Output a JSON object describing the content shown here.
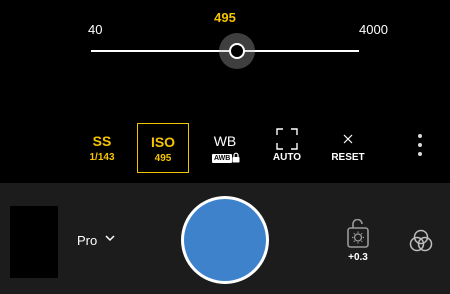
{
  "slider": {
    "value": "495",
    "min_label": "40",
    "max_label": "4000",
    "level_fraction": 0.55
  },
  "modes": {
    "ss": {
      "label": "SS",
      "value": "1/143"
    },
    "iso": {
      "label": "ISO",
      "value": "495",
      "selected": true
    },
    "wb": {
      "label": "WB",
      "badge": "AWB"
    },
    "focus": {
      "label": "AUTO",
      "icon": "focus-frame-icon"
    },
    "reset": {
      "label": "RESET",
      "icon": "close-icon"
    }
  },
  "more_icon": "more-vertical-icon",
  "bottom": {
    "mode_label": "Pro",
    "exposure_value": "+0.3",
    "filter_icon": "filter-icon"
  },
  "colors": {
    "accent": "#f5c400",
    "shutter": "#3f82cc",
    "bottom_bar": "#1c1c1c",
    "background": "#000000"
  }
}
